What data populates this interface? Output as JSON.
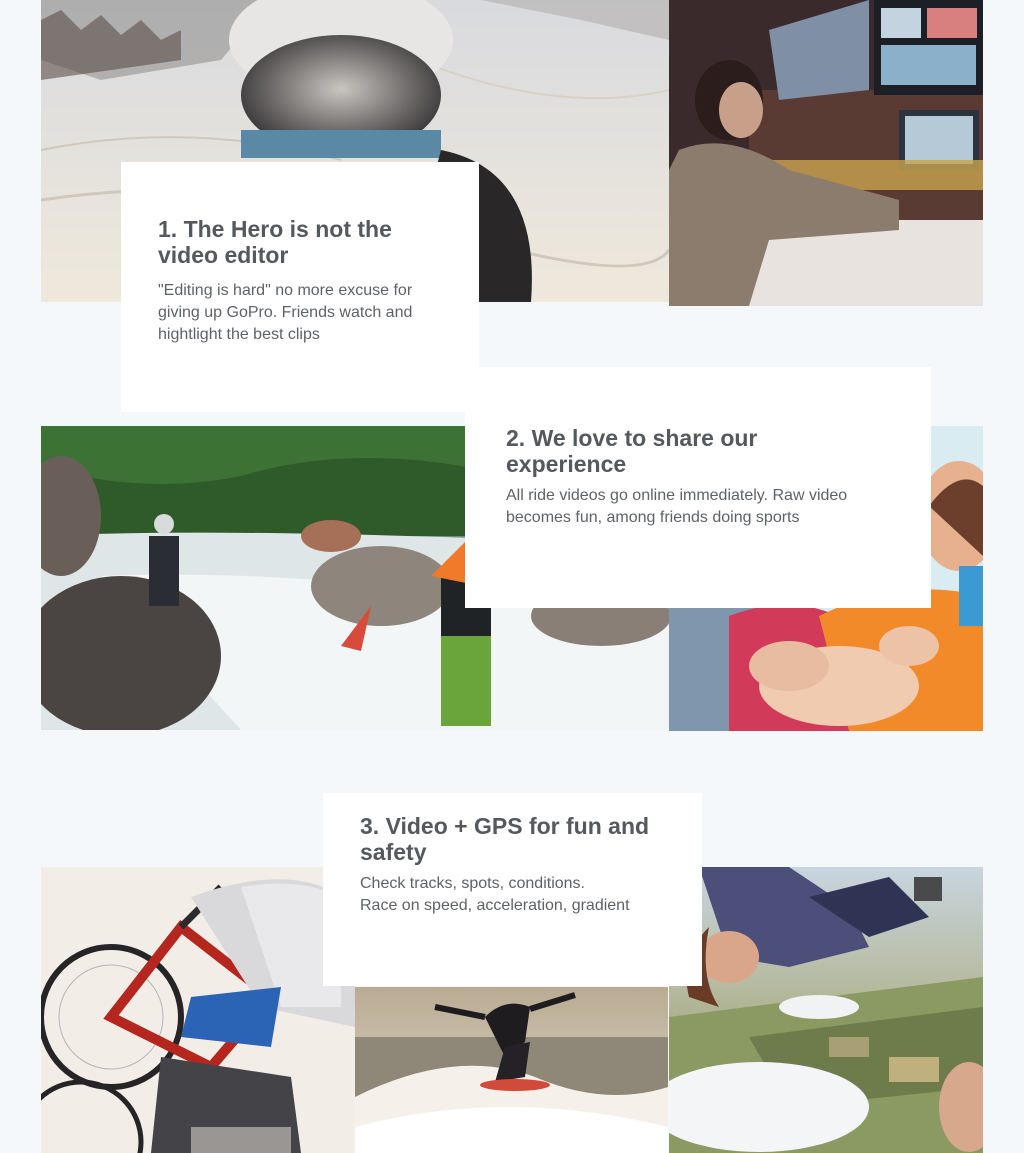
{
  "sections": [
    {
      "title": "1. The Hero is not the video editor",
      "description": "\"Editing is hard\" no more excuse for giving up GoPro. Friends watch and hightlight the best clips"
    },
    {
      "title": "2. We love to share our experience",
      "description": "All ride videos go online immediately. Raw video becomes fun, among friends doing sports"
    },
    {
      "title": "3. Video + GPS for fun and safety",
      "description_lines": [
        "Check tracks, spots, conditions.",
        "Race on speed, acceleration, gradient"
      ]
    }
  ],
  "photos": [
    {
      "name": "ski-helmet-selfie-photo"
    },
    {
      "name": "video-editing-room-photo"
    },
    {
      "name": "kayak-river-rapids-photo"
    },
    {
      "name": "friends-high-five-photo"
    },
    {
      "name": "bmx-rider-photo"
    },
    {
      "name": "surfer-wave-photo"
    },
    {
      "name": "skydivers-photo"
    }
  ]
}
